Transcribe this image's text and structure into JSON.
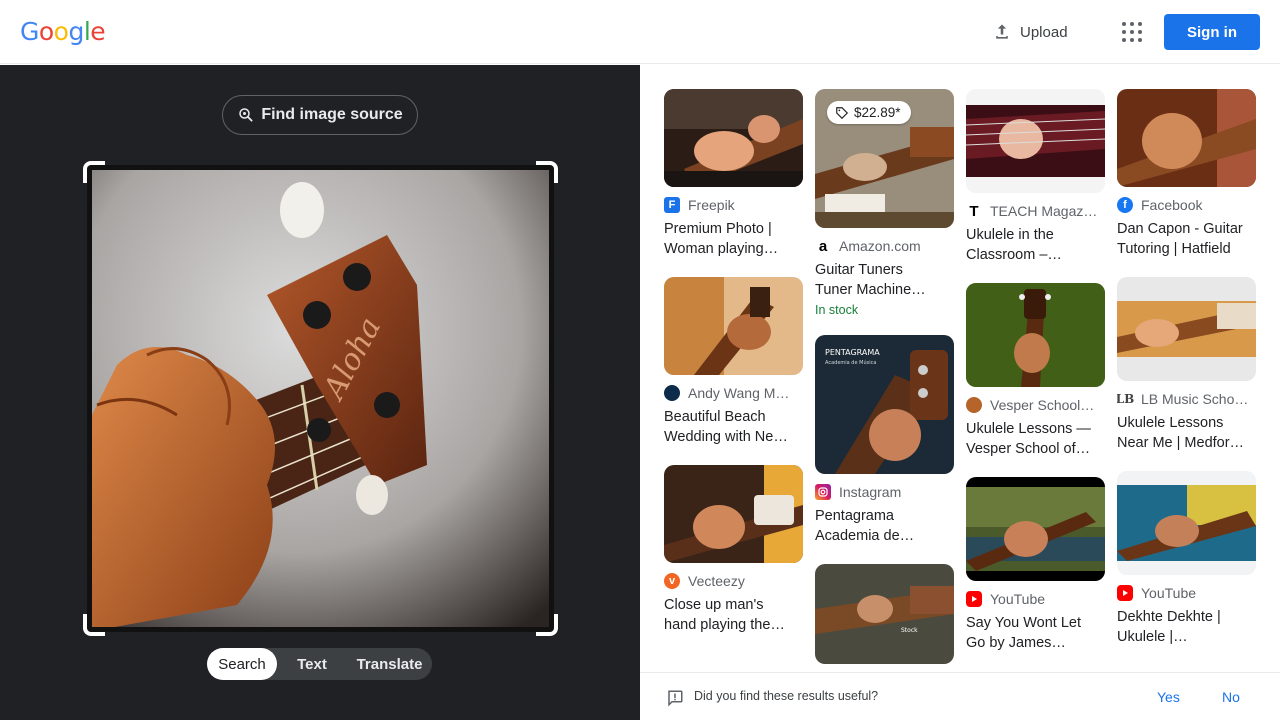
{
  "header": {
    "logo_letters": [
      {
        "ch": "G",
        "color": "#4285f4"
      },
      {
        "ch": "o",
        "color": "#ea4335"
      },
      {
        "ch": "o",
        "color": "#fbbc05"
      },
      {
        "ch": "g",
        "color": "#4285f4"
      },
      {
        "ch": "l",
        "color": "#34a853"
      },
      {
        "ch": "e",
        "color": "#ea4335"
      }
    ],
    "upload_label": "Upload",
    "signin_label": "Sign in"
  },
  "left_panel": {
    "find_source_label": "Find image source",
    "modes": [
      "Search",
      "Text",
      "Translate"
    ],
    "active_mode": "Search"
  },
  "results": {
    "columns": [
      [
        {
          "source": "Freepik",
          "favicon": "freepik",
          "title_lines": [
            "Premium Photo |",
            "Woman playing…"
          ]
        },
        {
          "source": "Andy Wang M…",
          "favicon": "andy",
          "title_lines": [
            "Beautiful Beach",
            "Wedding with Ne…"
          ]
        },
        {
          "source": "Vecteezy",
          "favicon": "vecteezy",
          "title_lines": [
            "Close up man's",
            "hand playing the…"
          ]
        }
      ],
      [
        {
          "source": "Amazon.com",
          "favicon": "amazon",
          "title_lines": [
            "Guitar Tuners",
            "Tuner Machine…"
          ],
          "price": "$22.89*",
          "stock": "In stock"
        },
        {
          "source": "Instagram",
          "favicon": "instagram",
          "title_lines": [
            "Pentagrama",
            "Academia de…"
          ],
          "thumb_caption": "PENTAGRAMA",
          "thumb_subcaption": "Academia de Música"
        },
        {
          "source": "",
          "favicon": "",
          "title_lines": [],
          "thumb_caption": "Stock"
        }
      ],
      [
        {
          "source": "TEACH Magaz…",
          "favicon": "teach",
          "title_lines": [
            "Ukulele in the",
            "Classroom –…"
          ]
        },
        {
          "source": "Vesper School…",
          "favicon": "vesper",
          "title_lines": [
            "Ukulele Lessons —",
            "Vesper School of…"
          ]
        },
        {
          "source": "YouTube",
          "favicon": "youtube",
          "title_lines": [
            "Say You Wont Let",
            "Go by James…"
          ]
        }
      ],
      [
        {
          "source": "Facebook",
          "favicon": "facebook",
          "title_lines": [
            "Dan Capon - Guitar",
            "Tutoring | Hatfield"
          ]
        },
        {
          "source": "LB Music Scho…",
          "favicon": "lb",
          "title_lines": [
            "Ukulele Lessons",
            "Near Me | Medfor…"
          ]
        },
        {
          "source": "YouTube",
          "favicon": "youtube",
          "title_lines": [
            "Dekhte Dekhte |",
            "Ukulele |…"
          ]
        }
      ]
    ]
  },
  "feedback": {
    "question": "Did you find these results useful?",
    "yes_label": "Yes",
    "no_label": "No"
  }
}
